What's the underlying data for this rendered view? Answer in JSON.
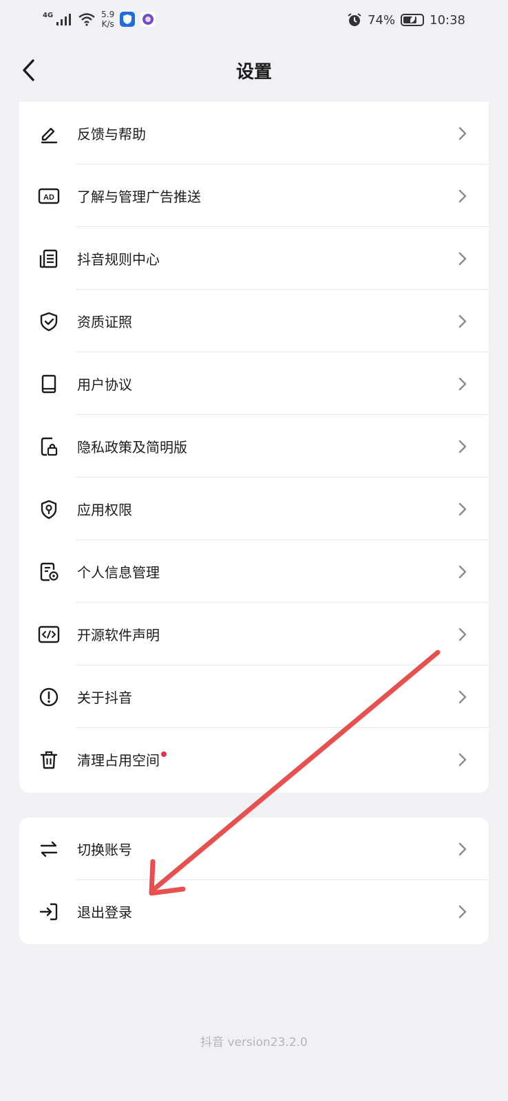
{
  "status_bar": {
    "network": "4G",
    "speed_value": "5.9",
    "speed_unit": "K/s",
    "battery_percent": "74%",
    "battery_level": 0.74,
    "time": "10:38"
  },
  "header": {
    "title": "设置"
  },
  "settings_list": [
    {
      "label": "反馈与帮助",
      "icon": "pencil-icon"
    },
    {
      "label": "了解与管理广告推送",
      "icon": "ad-icon"
    },
    {
      "label": "抖音规则中心",
      "icon": "rules-document-icon"
    },
    {
      "label": "资质证照",
      "icon": "shield-check-icon"
    },
    {
      "label": "用户协议",
      "icon": "book-icon"
    },
    {
      "label": "隐私政策及简明版",
      "icon": "privacy-lock-icon"
    },
    {
      "label": "应用权限",
      "icon": "location-shield-icon"
    },
    {
      "label": "个人信息管理",
      "icon": "personal-info-icon"
    },
    {
      "label": "开源软件声明",
      "icon": "code-icon"
    },
    {
      "label": "关于抖音",
      "icon": "info-circle-icon"
    },
    {
      "label": "清理占用空间",
      "icon": "trash-icon",
      "has_badge": true
    }
  ],
  "account_list": [
    {
      "label": "切换账号",
      "icon": "switch-arrows-icon"
    },
    {
      "label": "退出登录",
      "icon": "logout-icon"
    }
  ],
  "footer": {
    "version": "抖音 version23.2.0"
  },
  "colors": {
    "background": "#f1f1f3",
    "card": "#ffffff",
    "badge": "#e8304f",
    "annotation_arrow": "#e8504f"
  }
}
